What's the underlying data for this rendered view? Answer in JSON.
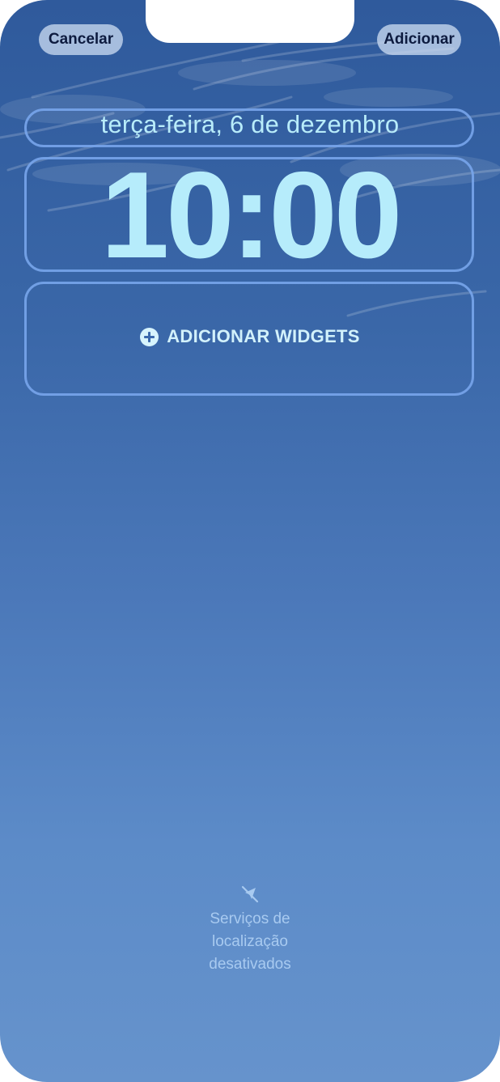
{
  "header": {
    "cancel_label": "Cancelar",
    "add_label": "Adicionar"
  },
  "lockscreen": {
    "date": "terça-feira, 6 de dezembro",
    "time": "10:00",
    "add_widgets_label": "ADICIONAR WIDGETS"
  },
  "location_status": {
    "icon": "location-off-icon",
    "line1": "Serviços de",
    "line2": "localização",
    "line3": "desativados"
  },
  "colors": {
    "wallpaper_top": "#2f5a9c",
    "wallpaper_bottom": "#6693cc",
    "clock_text": "#b6ecfb",
    "frame_border": "#78a5eb"
  }
}
